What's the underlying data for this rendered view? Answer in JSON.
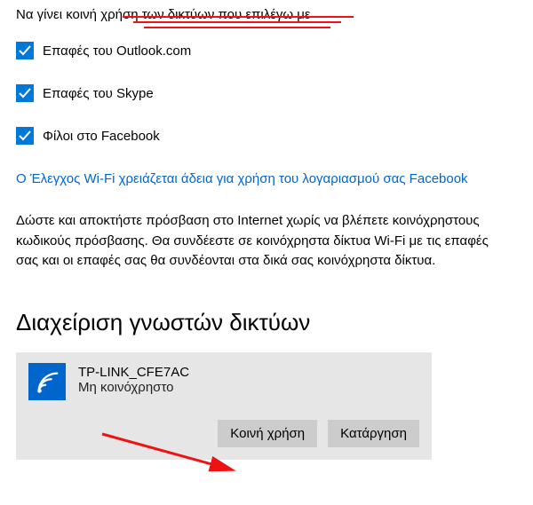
{
  "intro": "Να γίνει κοινή χρήση των δικτύων που επιλέγω με",
  "checkboxes": {
    "outlook": "Επαφές του Outlook.com",
    "skype": "Επαφές του Skype",
    "facebook": "Φίλοι στο Facebook"
  },
  "permission_link": "Ο Έλεγχος Wi-Fi χρειάζεται άδεια για χρήση του λογαριασμού σας Facebook",
  "description": "Δώστε και αποκτήστε πρόσβαση στο Internet χωρίς να βλέπετε κοινόχρηστους κωδικούς πρόσβασης. Θα συνδέεστε σε κοινόχρηστα δίκτυα Wi-Fi με τις επαφές σας και οι επαφές σας θα συνδέονται στα δικά σας κοινόχρηστα δίκτυα.",
  "section_title": "Διαχείριση γνωστών δικτύων",
  "network": {
    "name": "TP-LINK_CFE7AC",
    "status": "Μη κοινόχρηστο",
    "share_btn": "Κοινή χρήση",
    "remove_btn": "Κατάργηση"
  }
}
